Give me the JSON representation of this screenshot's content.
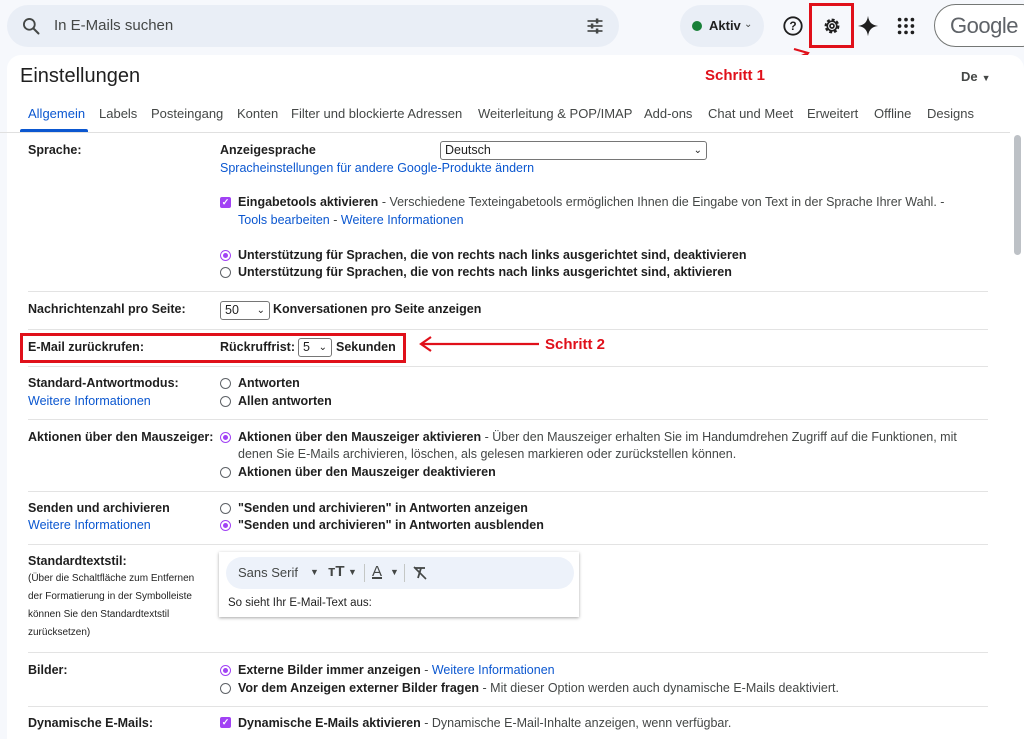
{
  "search": {
    "placeholder": "In E-Mails suchen"
  },
  "status": {
    "label": "Aktiv"
  },
  "account": {
    "logo_text": "Google",
    "language_button": "De"
  },
  "page": {
    "title": "Einstellungen"
  },
  "annotations": {
    "step1": "Schritt 1",
    "step2": "Schritt 2"
  },
  "tabs": [
    {
      "label": "Allgemein"
    },
    {
      "label": "Labels"
    },
    {
      "label": "Posteingang"
    },
    {
      "label": "Konten"
    },
    {
      "label": "Filter und blockierte Adressen"
    },
    {
      "label": "Weiterleitung & POP/IMAP"
    },
    {
      "label": "Add-ons"
    },
    {
      "label": "Chat und Meet"
    },
    {
      "label": "Erweitert"
    },
    {
      "label": "Offline"
    },
    {
      "label": "Designs"
    }
  ],
  "language": {
    "label": "Sprache:",
    "display_label": "Anzeigesprache",
    "display_value": "Deutsch",
    "other_products_link": "Spracheinstellungen für andere Google-Produkte ändern",
    "input_tools_bold": "Eingabetools aktivieren",
    "input_tools_desc": "- Verschiedene Texteingabetools ermöglichen Ihnen die Eingabe von Text in der Sprache Ihrer Wahl. -",
    "edit_tools_link": "Tools bearbeiten",
    "dash": "-",
    "more_info_link": "Weitere Informationen",
    "rtl_off": "Unterstützung für Sprachen, die von rechts nach links ausgerichtet sind, deaktivieren",
    "rtl_on": "Unterstützung für Sprachen, die von rechts nach links ausgerichtet sind, aktivieren"
  },
  "page_size": {
    "label": "Nachrichtenzahl pro Seite:",
    "value": "50",
    "suffix": "Konversationen pro Seite anzeigen"
  },
  "undo_send": {
    "label": "E-Mail zurückrufen:",
    "period_label": "Rückruffrist:",
    "value": "5",
    "unit": "Sekunden"
  },
  "reply_mode": {
    "label": "Standard-Antwortmodus:",
    "more_info_link": "Weitere Informationen",
    "option1": "Antworten",
    "option2": "Allen antworten"
  },
  "hover_actions": {
    "label": "Aktionen über den Mauszeiger:",
    "option1_bold": "Aktionen über den Mauszeiger aktivieren",
    "option1_desc": "- Über den Mauszeiger erhalten Sie im Handumdrehen Zugriff auf die Funktionen, mit",
    "option1_desc2": "denen Sie E-Mails archivieren, löschen, als gelesen markieren oder zurückstellen können.",
    "option2": "Aktionen über den Mauszeiger deaktivieren"
  },
  "send_archive": {
    "label": "Senden und archivieren",
    "more_info_link": "Weitere Informationen",
    "option1": "\"Senden und archivieren\" in Antworten anzeigen",
    "option2": "\"Senden und archivieren\" in Antworten ausblenden"
  },
  "text_style": {
    "label": "Standardtextstil:",
    "help_line1": "(Über die Schaltfläche zum Entfernen",
    "help_line2": "der Formatierung in der Symbolleiste",
    "help_line3": "können Sie den Standardtextstil",
    "help_line4": "zurücksetzen)",
    "font": "Sans Serif",
    "sample": "So sieht Ihr E-Mail-Text aus:"
  },
  "images": {
    "label": "Bilder:",
    "option1_bold": "Externe Bilder immer anzeigen",
    "dash": "-",
    "more_info_link": "Weitere Informationen",
    "option2_bold": "Vor dem Anzeigen externer Bilder fragen",
    "option2_desc": "- Mit dieser Option werden auch dynamische E-Mails deaktiviert."
  },
  "dynamic_mail": {
    "label": "Dynamische E-Mails:",
    "option_bold": "Dynamische E-Mails aktivieren",
    "option_desc": "- Dynamische E-Mail-Inhalte anzeigen, wenn verfügbar."
  },
  "colors": {
    "accent": "#0b57d0",
    "annotation": "#e0101a",
    "radio": "#a142f4",
    "status_dot": "#188038"
  }
}
